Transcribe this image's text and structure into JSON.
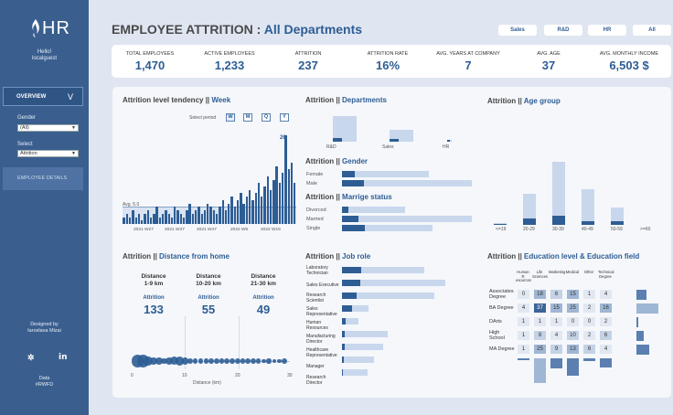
{
  "sidebar": {
    "logo_text": "HR",
    "greeting": [
      "Hello!",
      "localguest"
    ],
    "nav_overview": "OVERVIEW",
    "nav_chevron": "V",
    "gender_label": "Gender",
    "gender_value": "(All)",
    "select_label": "Select",
    "select_value": "Attrition",
    "nav_details": "EMPLOYEE DETAILS",
    "designed_by": [
      "Designed by",
      "Iaroslava Mizai"
    ],
    "data_by": [
      "Data",
      "#RWFD"
    ]
  },
  "header": {
    "title_prefix": "EMPLOYEE ATTRITION : ",
    "title_department": "All Departments",
    "filters": [
      "Sales",
      "R&D",
      "HR",
      "All"
    ]
  },
  "kpis": [
    {
      "label": "TOTAL EMPLOYEES",
      "value": "1,470"
    },
    {
      "label": "ACTIVE EMPLOYEES",
      "value": "1,233"
    },
    {
      "label": "ATTRITION",
      "value": "237"
    },
    {
      "label": "ATTRITION RATE",
      "value": "16%"
    },
    {
      "label": "AVG. YEARS AT COMPANY",
      "value": "7"
    },
    {
      "label": "AVG. AGE",
      "value": "37"
    },
    {
      "label": "AVG. MONTHLY INCOME",
      "value": "6,503 $"
    }
  ],
  "colors": {
    "primary": "#2e5d94",
    "light": "#c8d7ec",
    "sidebar": "#3a5f8f"
  },
  "tendency": {
    "title_a": "Attrition level tendency ",
    "title_sep": "|| ",
    "title_b": "Week",
    "select_period_label": "Select period",
    "periods": [
      "W",
      "M",
      "Q",
      "Y"
    ],
    "avg_label": "Avg. 5.0",
    "peak_label": "26",
    "x_labels": [
      "2021 W27",
      "2021 W37",
      "2021 W47",
      "2022 W5",
      "2022 W15"
    ]
  },
  "departments": {
    "title_a": "Attrition ",
    "title_sep": "|| ",
    "title_b": "Departments",
    "labels": [
      "R&D",
      "Sales",
      "HR"
    ]
  },
  "gender": {
    "title_a": "Attrition ",
    "title_sep": "|| ",
    "title_b": "Gender",
    "labels": [
      "Female",
      "Male"
    ]
  },
  "marriage": {
    "title_a": "Attrition ",
    "title_sep": "|| ",
    "title_b": "Marrige status",
    "labels": [
      "Divorced",
      "Married",
      "Single"
    ]
  },
  "age": {
    "title_a": "Attrition ",
    "title_sep": "|| ",
    "title_b": "Age group",
    "labels": [
      "<=19",
      "20-29",
      "30-39",
      "40-49",
      "50-59",
      ">=60"
    ]
  },
  "distance": {
    "title_a": "Attrition ",
    "title_sep": "|| ",
    "title_b": "Distance from home",
    "groups": [
      {
        "title": [
          "Distance",
          "1-9 km"
        ],
        "attr_label": "Attrition",
        "value": "133"
      },
      {
        "title": [
          "Distance",
          "10-20 km"
        ],
        "attr_label": "Attrition",
        "value": "55"
      },
      {
        "title": [
          "Distance",
          "21-30 km"
        ],
        "attr_label": "Attrition",
        "value": "49"
      }
    ],
    "axis_ticks": [
      "0",
      "10",
      "20",
      "30"
    ],
    "axis_label": "Distance (km)"
  },
  "jobrole": {
    "title_a": "Attrition ",
    "title_sep": "|| ",
    "title_b": "Job role",
    "labels": [
      [
        "Laboratory",
        "Technician"
      ],
      [
        "Sales Executive"
      ],
      [
        "Research",
        "Scientist"
      ],
      [
        "Sales",
        "Representative"
      ],
      [
        "Human",
        "Resources"
      ],
      [
        "Manufacturing",
        "Director"
      ],
      [
        "Healthcare",
        "Representative"
      ],
      [
        "Manager"
      ],
      [
        "Research",
        "Director"
      ]
    ]
  },
  "education": {
    "title_a": "Attrition ",
    "title_sep": "|| ",
    "title_b": "Education level & Education field",
    "columns": [
      [
        "Human R",
        "esources"
      ],
      [
        "Life",
        "Sciences"
      ],
      [
        "Marketing"
      ],
      [
        "Medical"
      ],
      [
        "Other"
      ],
      [
        "Technical",
        "Degree"
      ]
    ],
    "rows": [
      {
        "label": [
          "Associates",
          "Degree"
        ],
        "values": [
          "0",
          "18",
          "6",
          "15",
          "1",
          "4"
        ]
      },
      {
        "label": [
          "BA Degree"
        ],
        "values": [
          "4",
          "37",
          "15",
          "25",
          "2",
          "16"
        ]
      },
      {
        "label": [
          "DArts"
        ],
        "values": [
          "1",
          "1",
          "1",
          "0",
          "0",
          "2"
        ]
      },
      {
        "label": [
          "High",
          "School"
        ],
        "values": [
          "1",
          "8",
          "4",
          "10",
          "2",
          "6"
        ]
      },
      {
        "label": [
          "MA Degree"
        ],
        "values": [
          "1",
          "25",
          "9",
          "13",
          "6",
          "4"
        ]
      }
    ]
  },
  "chart_data": [
    {
      "type": "bar",
      "title": "Attrition level tendency || Week",
      "x_labels": [
        "2021 W27",
        "2021 W37",
        "2021 W47",
        "2022 W5",
        "2022 W15"
      ],
      "values": [
        2,
        3,
        2,
        4,
        2,
        3,
        1,
        3,
        4,
        2,
        3,
        5,
        2,
        3,
        4,
        3,
        2,
        5,
        4,
        3,
        2,
        4,
        6,
        3,
        4,
        5,
        3,
        4,
        6,
        5,
        4,
        3,
        5,
        7,
        4,
        6,
        8,
        5,
        7,
        9,
        6,
        8,
        10,
        7,
        9,
        12,
        8,
        11,
        14,
        10,
        13,
        17,
        12,
        15,
        26,
        16,
        18,
        12
      ],
      "avg": 5.0,
      "max_label": 26
    },
    {
      "type": "bar",
      "title": "Attrition || Departments",
      "categories": [
        "R&D",
        "Sales",
        "HR"
      ],
      "values": [
        133,
        92,
        12
      ],
      "totals": [
        961,
        446,
        63
      ]
    },
    {
      "type": "bar",
      "title": "Attrition || Gender",
      "categories": [
        "Female",
        "Male"
      ],
      "values": [
        87,
        150
      ],
      "totals": [
        588,
        882
      ]
    },
    {
      "type": "bar",
      "title": "Attrition || Marrige status",
      "categories": [
        "Divorced",
        "Married",
        "Single"
      ],
      "values": [
        33,
        84,
        120
      ],
      "totals": [
        327,
        673,
        470
      ]
    },
    {
      "type": "bar",
      "title": "Attrition || Age group",
      "categories": [
        "<=19",
        "20-29",
        "30-39",
        "40-49",
        "50-59",
        ">=60"
      ],
      "values": [
        10,
        62,
        90,
        38,
        37,
        0
      ],
      "totals": [
        17,
        309,
        622,
        349,
        173,
        0
      ]
    },
    {
      "type": "bar",
      "title": "Attrition || Job role",
      "categories": [
        "Laboratory Technician",
        "Sales Executive",
        "Research Scientist",
        "Sales Representative",
        "Human Resources",
        "Manufacturing Director",
        "Healthcare Representative",
        "Manager",
        "Research Director"
      ],
      "values": [
        62,
        57,
        47,
        33,
        12,
        10,
        9,
        5,
        2
      ],
      "totals": [
        259,
        326,
        292,
        83,
        52,
        145,
        131,
        102,
        80
      ]
    },
    {
      "type": "scatter",
      "title": "Attrition || Distance from home",
      "xlabel": "Distance (km)",
      "xlim": [
        0,
        30
      ],
      "x": [
        1,
        2,
        3,
        4,
        5,
        6,
        7,
        8,
        9,
        10,
        11,
        12,
        13,
        14,
        15,
        16,
        17,
        18,
        19,
        20,
        21,
        22,
        23,
        24,
        25,
        26,
        27,
        28,
        29
      ],
      "sizes": [
        26,
        28,
        14,
        9,
        10,
        7,
        11,
        12,
        13,
        8,
        6,
        4,
        5,
        4,
        5,
        6,
        5,
        6,
        5,
        5,
        4,
        6,
        5,
        4,
        3,
        4,
        3,
        3,
        5
      ]
    },
    {
      "type": "heatmap",
      "title": "Attrition || Education level & Education field",
      "x_categories": [
        "Human Resources",
        "Life Sciences",
        "Marketing",
        "Medical",
        "Other",
        "Technical Degree"
      ],
      "y_categories": [
        "Associates Degree",
        "BA Degree",
        "DArts",
        "High School",
        "MA Degree"
      ],
      "values": [
        [
          0,
          18,
          6,
          15,
          1,
          4
        ],
        [
          4,
          37,
          15,
          25,
          2,
          16
        ],
        [
          1,
          1,
          1,
          0,
          0,
          2
        ],
        [
          1,
          8,
          4,
          10,
          2,
          6
        ],
        [
          1,
          25,
          9,
          13,
          6,
          4
        ]
      ]
    }
  ]
}
